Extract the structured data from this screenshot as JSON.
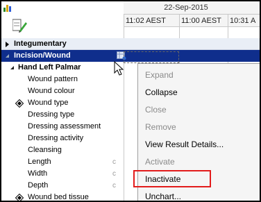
{
  "header": {
    "date": "22-Sep-2015",
    "times": [
      "11:02 AEST",
      "11:00 AEST",
      "10:31 A"
    ]
  },
  "tree": {
    "section_integumentary": "Integumentary",
    "section_incision": "Incision/Wound",
    "subsection": "Hand Left Palmar",
    "items": [
      {
        "label": "Wound pattern",
        "flag": ""
      },
      {
        "label": "Wound colour",
        "flag": ""
      },
      {
        "label": "Wound type",
        "flag": ""
      },
      {
        "label": "Dressing type",
        "flag": ""
      },
      {
        "label": "Dressing assessment",
        "flag": ""
      },
      {
        "label": "Dressing activity",
        "flag": ""
      },
      {
        "label": "Cleansing",
        "flag": ""
      },
      {
        "label": "Length",
        "flag": "c"
      },
      {
        "label": "Width",
        "flag": "c"
      },
      {
        "label": "Depth",
        "flag": "c"
      },
      {
        "label": "Wound bed tissue",
        "flag": ""
      }
    ]
  },
  "context_menu": {
    "items": [
      {
        "label": "Expand",
        "enabled": false
      },
      {
        "label": "Collapse",
        "enabled": true
      },
      {
        "label": "Close",
        "enabled": false
      },
      {
        "label": "Remove",
        "enabled": false
      },
      {
        "label": "View Result Details...",
        "enabled": true
      },
      {
        "label": "Activate",
        "enabled": false
      },
      {
        "label": "Inactivate",
        "enabled": true
      },
      {
        "label": "Unchart...",
        "enabled": true
      }
    ],
    "highlighted": "Inactivate",
    "highlight_color": "#e21b1b"
  },
  "colors": {
    "selected_row": "#0f2e8c",
    "section_row": "#e9eef6"
  }
}
